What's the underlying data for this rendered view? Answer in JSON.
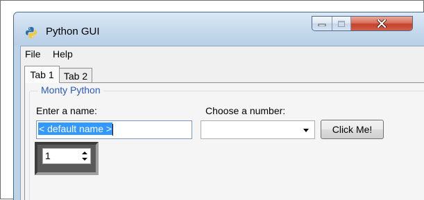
{
  "window": {
    "title": "Python GUI",
    "icon": "python-icon",
    "controls": {
      "minimize_icon": "minimize-icon",
      "maximize_icon": "maximize-icon",
      "close_icon": "close-icon"
    }
  },
  "menubar": {
    "items": [
      {
        "label": "File"
      },
      {
        "label": "Help"
      }
    ]
  },
  "tabs": [
    {
      "label": "Tab 1",
      "selected": true
    },
    {
      "label": "Tab 2",
      "selected": false
    }
  ],
  "group": {
    "title": "Monty Python",
    "name_label": "Enter a name:",
    "name_value": "< default name >",
    "number_label": "Choose a number:",
    "number_value": "",
    "button_label": "Click Me!",
    "spin_value": "1"
  },
  "colors": {
    "legend": "#2a59c2",
    "selection": "#3399ff",
    "close_button": "#c4412a"
  }
}
